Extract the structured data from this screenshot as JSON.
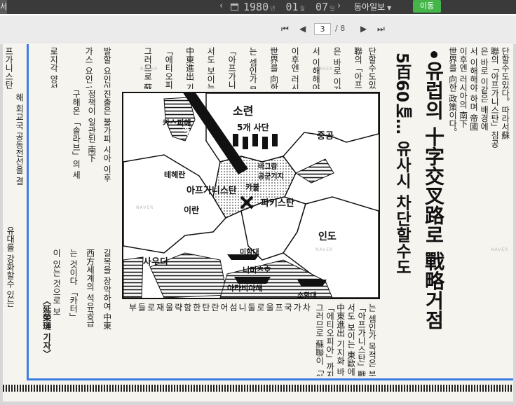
{
  "toolbar": {
    "edge_mark": "서",
    "prev_icon": "‹",
    "year": "1980",
    "year_unit": "년",
    "month": "01",
    "month_unit": "월",
    "day": "07",
    "day_unit": "일",
    "next_icon": "›",
    "newspaper": "동아일보",
    "move_label": "이동"
  },
  "pager": {
    "first_icon": "⏮",
    "prev_icon": "◀",
    "current_page": "3",
    "separator_total": "/ 8",
    "next_icon": "▶",
    "last_icon": "⏭"
  },
  "article": {
    "headline_main": "•유럽의 十字交叉路로 戰略거점",
    "headline_sub": "5百60㎞… 유사시 차단할수도",
    "columns": [
      "단할수도있다。따라서蘇",
      "聯의「아프가니스탄」침공",
      "은 바로 이같은 배경에",
      "서 이해해야 하며 帝國",
      "이후엔 러시아의 南下",
      "世界를 向한 政策이다。",
      "는 셈인가 목적은 분명",
      "「아프가니스탄」戰爭에",
      "서도 보이는 東歐에서와",
      "中東進出 기지화 바로",
      "「에티오피아」까지 진출",
      "그러므로 蘇聯이「아프"
    ],
    "left_columns": [
      "프가니스탄",
      "해 회교국 공동전선을 결",
      "유대를 강화할수 있는",
      "진출은 불가피 시아 이후",
      "정책이 일관된 南下",
      "구해온 「솔라브」의 세",
      "발할 요인이 없어 추",
      "가스 요인 다",
      "로지각 양성",
      "길목을 장악하여 中東",
      "西方세계의 석유공급",
      "는 것이다 「카터」",
      "이 있는 것으로 보",
      "〈延榮璉 기자〉"
    ],
    "bottom_row": "부들로재울략함한탄란어섬니둘로울프국가차"
  },
  "map": {
    "labels": {
      "ussr": "소련",
      "five_divisions": "5개 사단",
      "caspian": "카스피해",
      "china": "중공",
      "tehran": "테헤란",
      "bagram": "바그람",
      "airbase": "공군기지",
      "kabul": "카불",
      "afghanistan": "아프가니스탄",
      "pakistan": "파키스탄",
      "iran": "이란",
      "india": "인도",
      "saudi": "사우디",
      "fleet": "미함대",
      "nimitz": "니미츠호",
      "arabian_sea": "아라비아해",
      "sobang": "소항대",
      "distance": "560㎞",
      "watermark": "NAVER"
    }
  }
}
